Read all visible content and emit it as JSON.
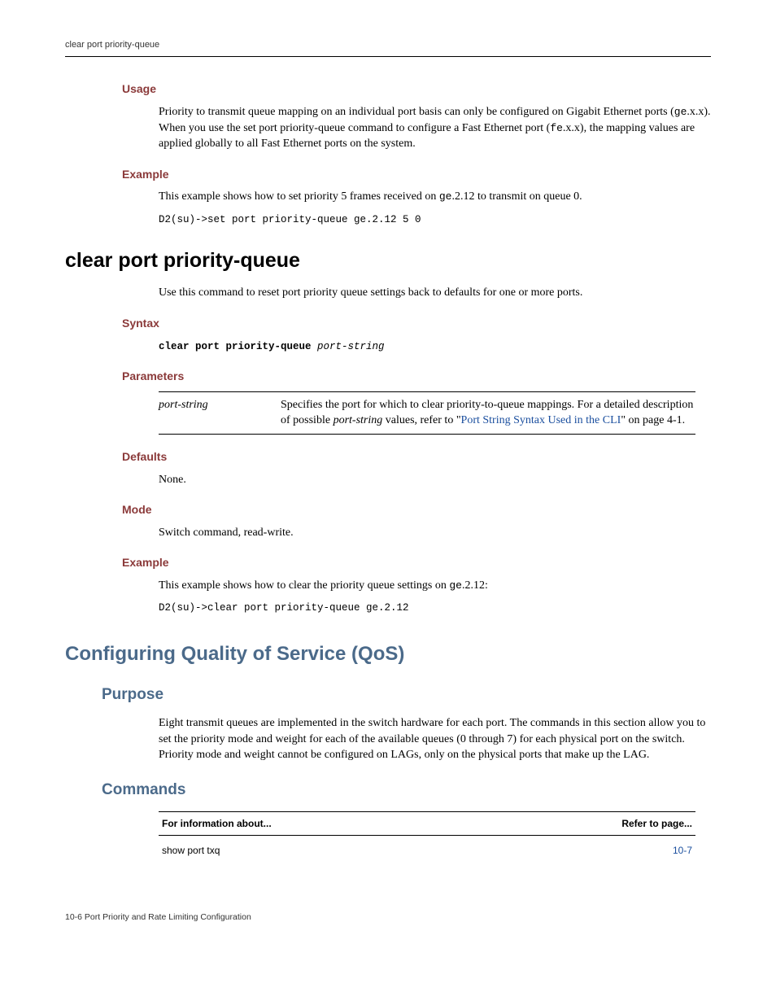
{
  "header": {
    "running": "clear port priority-queue"
  },
  "usage": {
    "heading": "Usage",
    "text_1": "Priority to transmit queue mapping on an individual port basis can only be configured on Gigabit Ethernet ports (",
    "inline_1": "ge",
    "text_2": ".x.x). When you use the set port priority-queue command to configure a Fast Ethernet port (",
    "inline_2": "fe",
    "text_3": ".x.x), the mapping values are applied globally to all Fast Ethernet ports on the system."
  },
  "example1": {
    "heading": "Example",
    "text_1": "This example shows how to set priority 5 frames received on ",
    "inline_1": "ge",
    "text_2": ".2.12 to transmit on queue 0.",
    "code": "D2(su)->set port priority-queue ge.2.12 5 0"
  },
  "clear": {
    "title": "clear port priority-queue",
    "intro": "Use this command to reset port priority queue settings back to defaults for one or more ports.",
    "syntax_heading": "Syntax",
    "syntax_bold": "clear port priority-queue ",
    "syntax_ital": "port-string",
    "params_heading": "Parameters",
    "param_name": "port‑string",
    "param_desc_1": "Specifies the port for which to clear priority-to-queue mappings. For a detailed description of possible ",
    "param_desc_ital": "port‑string",
    "param_desc_2": " values, refer to \"",
    "param_link": "Port String Syntax Used in the CLI",
    "param_desc_3": "\" on page 4‑1.",
    "defaults_heading": "Defaults",
    "defaults_text": "None.",
    "mode_heading": "Mode",
    "mode_text": "Switch command, read‑write.",
    "ex_heading": "Example",
    "ex_text_1": "This example shows how to clear the priority queue settings on ",
    "ex_inline": "ge",
    "ex_text_2": ".2.12:",
    "ex_code": "D2(su)->clear port priority-queue ge.2.12"
  },
  "qos": {
    "title": "Configuring Quality of Service (QoS)",
    "purpose_heading": "Purpose",
    "purpose_text": "Eight transmit queues are implemented in the switch hardware for each port. The commands in this section allow you to set the priority mode and weight for each of the available queues (0 through 7) for each physical port on the switch. Priority mode and weight cannot be configured on LAGs, only on the physical ports that make up the LAG.",
    "commands_heading": "Commands",
    "th1": "For information about...",
    "th2": "Refer to page...",
    "row1_cmd": "show port txq",
    "row1_page": "10-7"
  },
  "footer": {
    "text": "10-6   Port Priority and Rate Limiting Configuration"
  }
}
